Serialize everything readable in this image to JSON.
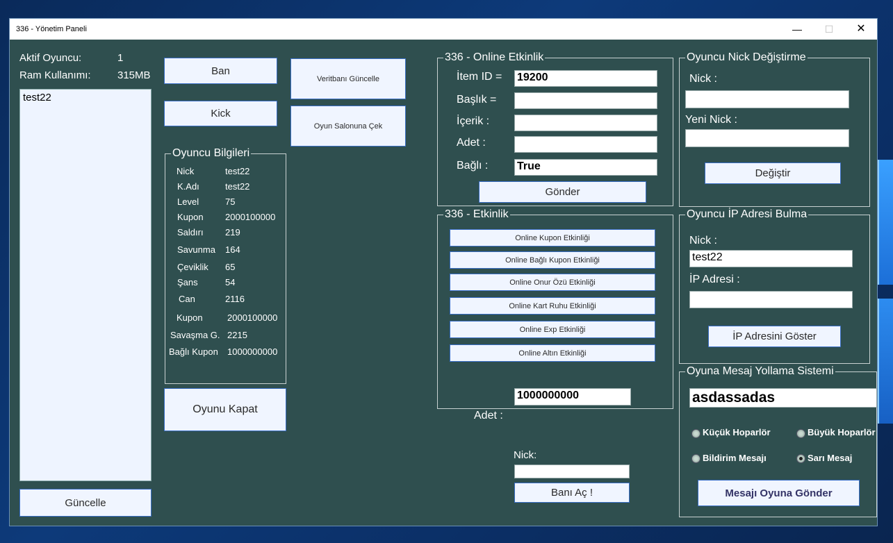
{
  "window": {
    "title": "336 - Yönetim Paneli"
  },
  "status": {
    "aktif_label": "Aktif Oyuncu:",
    "aktif_value": "1",
    "ram_label": "Ram Kullanımı:",
    "ram_value": "315MB"
  },
  "player_list": [
    "test22"
  ],
  "buttons": {
    "ban": "Ban",
    "kick": "Kick",
    "veritabani": "Veritbanı Güncelle",
    "salon": "Oyun Salonuna Çek",
    "kapat": "Oyunu Kapat",
    "guncelle": "Güncelle",
    "gonder": "Gönder",
    "degistir": "Değiştir",
    "ip_goster": "İP Adresini Göster",
    "bani_ac": "Banı Aç !",
    "mesaj_gonder": "Mesajı Oyuna Gönder"
  },
  "player_info": {
    "title": "Oyuncu Bilgileri",
    "rows": [
      {
        "k": "Nick",
        "v": "test22"
      },
      {
        "k": "K.Adı",
        "v": "test22"
      },
      {
        "k": "Level",
        "v": "75"
      },
      {
        "k": "Kupon",
        "v": "2000100000"
      },
      {
        "k": "Saldırı",
        "v": "219"
      },
      {
        "k": "Savunma",
        "v": "164"
      },
      {
        "k": "Çeviklik",
        "v": "65"
      },
      {
        "k": "Şans",
        "v": "54"
      },
      {
        "k": "Can",
        "v": "2116"
      },
      {
        "k": "Kupon",
        "v": "2000100000"
      },
      {
        "k": "Savaşma G.",
        "v": "2215"
      },
      {
        "k": "Bağlı Kupon",
        "v": "1000000000"
      }
    ]
  },
  "online_event": {
    "title": "336 - Online Etkinlik",
    "item_label": "İtem ID =",
    "item_value": "19200",
    "baslik_label": "Başlık =",
    "baslik_value": "",
    "icerik_label": "İçerik :",
    "icerik_value": "",
    "adet_label": "Adet :",
    "adet_value": "",
    "bagli_label": "Bağlı :",
    "bagli_value": "True"
  },
  "event": {
    "title": "336 - Etkinlik",
    "items": [
      "Online Kupon Etkinliği",
      "Online Bağlı Kupon Etkinliği",
      "Online Onur Özü Etkinliği",
      "Online Kart Ruhu Etkinliği",
      "Online Exp Etkinliği",
      "Online Altın Etkinliği"
    ],
    "adet_label": "Adet :",
    "adet_value": "1000000000"
  },
  "unban": {
    "nick_label": "Nick:",
    "nick_value": ""
  },
  "nick_change": {
    "title": "Oyuncu Nick Değiştirme",
    "nick_label": "Nick :",
    "nick_value": "",
    "new_label": "Yeni Nick :",
    "new_value": ""
  },
  "ip_find": {
    "title": "Oyuncu İP Adresi Bulma",
    "nick_label": "Nick :",
    "nick_value": "test22",
    "ip_label": "İP Adresi :",
    "ip_value": ""
  },
  "message": {
    "title": "Oyuna  Mesaj Yollama Sistemi",
    "text": "asdassadas",
    "options": [
      "Küçük Hoparlör",
      "Büyük Hoparlör",
      "Bildirim Mesajı",
      "Sarı Mesaj"
    ],
    "selected": "Sarı Mesaj"
  }
}
